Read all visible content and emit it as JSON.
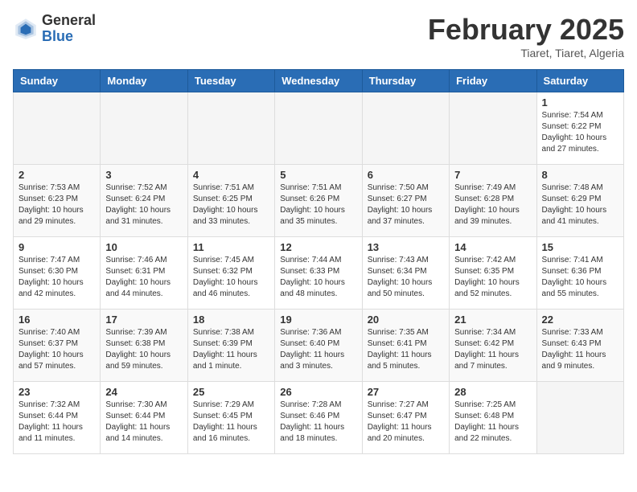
{
  "header": {
    "logo_general": "General",
    "logo_blue": "Blue",
    "month_title": "February 2025",
    "subtitle": "Tiaret, Tiaret, Algeria"
  },
  "days_of_week": [
    "Sunday",
    "Monday",
    "Tuesday",
    "Wednesday",
    "Thursday",
    "Friday",
    "Saturday"
  ],
  "weeks": [
    [
      {
        "day": "",
        "info": ""
      },
      {
        "day": "",
        "info": ""
      },
      {
        "day": "",
        "info": ""
      },
      {
        "day": "",
        "info": ""
      },
      {
        "day": "",
        "info": ""
      },
      {
        "day": "",
        "info": ""
      },
      {
        "day": "1",
        "info": "Sunrise: 7:54 AM\nSunset: 6:22 PM\nDaylight: 10 hours and 27 minutes."
      }
    ],
    [
      {
        "day": "2",
        "info": "Sunrise: 7:53 AM\nSunset: 6:23 PM\nDaylight: 10 hours and 29 minutes."
      },
      {
        "day": "3",
        "info": "Sunrise: 7:52 AM\nSunset: 6:24 PM\nDaylight: 10 hours and 31 minutes."
      },
      {
        "day": "4",
        "info": "Sunrise: 7:51 AM\nSunset: 6:25 PM\nDaylight: 10 hours and 33 minutes."
      },
      {
        "day": "5",
        "info": "Sunrise: 7:51 AM\nSunset: 6:26 PM\nDaylight: 10 hours and 35 minutes."
      },
      {
        "day": "6",
        "info": "Sunrise: 7:50 AM\nSunset: 6:27 PM\nDaylight: 10 hours and 37 minutes."
      },
      {
        "day": "7",
        "info": "Sunrise: 7:49 AM\nSunset: 6:28 PM\nDaylight: 10 hours and 39 minutes."
      },
      {
        "day": "8",
        "info": "Sunrise: 7:48 AM\nSunset: 6:29 PM\nDaylight: 10 hours and 41 minutes."
      }
    ],
    [
      {
        "day": "9",
        "info": "Sunrise: 7:47 AM\nSunset: 6:30 PM\nDaylight: 10 hours and 42 minutes."
      },
      {
        "day": "10",
        "info": "Sunrise: 7:46 AM\nSunset: 6:31 PM\nDaylight: 10 hours and 44 minutes."
      },
      {
        "day": "11",
        "info": "Sunrise: 7:45 AM\nSunset: 6:32 PM\nDaylight: 10 hours and 46 minutes."
      },
      {
        "day": "12",
        "info": "Sunrise: 7:44 AM\nSunset: 6:33 PM\nDaylight: 10 hours and 48 minutes."
      },
      {
        "day": "13",
        "info": "Sunrise: 7:43 AM\nSunset: 6:34 PM\nDaylight: 10 hours and 50 minutes."
      },
      {
        "day": "14",
        "info": "Sunrise: 7:42 AM\nSunset: 6:35 PM\nDaylight: 10 hours and 52 minutes."
      },
      {
        "day": "15",
        "info": "Sunrise: 7:41 AM\nSunset: 6:36 PM\nDaylight: 10 hours and 55 minutes."
      }
    ],
    [
      {
        "day": "16",
        "info": "Sunrise: 7:40 AM\nSunset: 6:37 PM\nDaylight: 10 hours and 57 minutes."
      },
      {
        "day": "17",
        "info": "Sunrise: 7:39 AM\nSunset: 6:38 PM\nDaylight: 10 hours and 59 minutes."
      },
      {
        "day": "18",
        "info": "Sunrise: 7:38 AM\nSunset: 6:39 PM\nDaylight: 11 hours and 1 minute."
      },
      {
        "day": "19",
        "info": "Sunrise: 7:36 AM\nSunset: 6:40 PM\nDaylight: 11 hours and 3 minutes."
      },
      {
        "day": "20",
        "info": "Sunrise: 7:35 AM\nSunset: 6:41 PM\nDaylight: 11 hours and 5 minutes."
      },
      {
        "day": "21",
        "info": "Sunrise: 7:34 AM\nSunset: 6:42 PM\nDaylight: 11 hours and 7 minutes."
      },
      {
        "day": "22",
        "info": "Sunrise: 7:33 AM\nSunset: 6:43 PM\nDaylight: 11 hours and 9 minutes."
      }
    ],
    [
      {
        "day": "23",
        "info": "Sunrise: 7:32 AM\nSunset: 6:44 PM\nDaylight: 11 hours and 11 minutes."
      },
      {
        "day": "24",
        "info": "Sunrise: 7:30 AM\nSunset: 6:44 PM\nDaylight: 11 hours and 14 minutes."
      },
      {
        "day": "25",
        "info": "Sunrise: 7:29 AM\nSunset: 6:45 PM\nDaylight: 11 hours and 16 minutes."
      },
      {
        "day": "26",
        "info": "Sunrise: 7:28 AM\nSunset: 6:46 PM\nDaylight: 11 hours and 18 minutes."
      },
      {
        "day": "27",
        "info": "Sunrise: 7:27 AM\nSunset: 6:47 PM\nDaylight: 11 hours and 20 minutes."
      },
      {
        "day": "28",
        "info": "Sunrise: 7:25 AM\nSunset: 6:48 PM\nDaylight: 11 hours and 22 minutes."
      },
      {
        "day": "",
        "info": ""
      }
    ]
  ]
}
